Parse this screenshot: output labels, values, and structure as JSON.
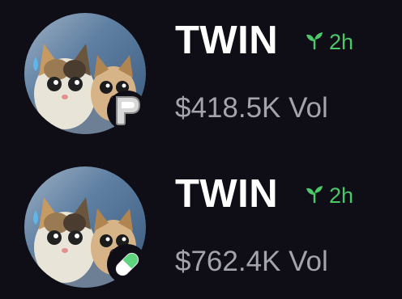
{
  "colors": {
    "background": "#0f0e17",
    "name": "#ffffff",
    "age": "#4cc76a",
    "volume": "#a4a4ae",
    "pill_green": "#5fd47e"
  },
  "tokens": [
    {
      "name": "TWIN",
      "age": "2h",
      "age_icon": "sprout-icon",
      "volume": "$418.5K Vol",
      "platform_icon": "p-logo-icon"
    },
    {
      "name": "TWIN",
      "age": "2h",
      "age_icon": "sprout-icon",
      "volume": "$762.4K Vol",
      "platform_icon": "pill-icon"
    }
  ]
}
